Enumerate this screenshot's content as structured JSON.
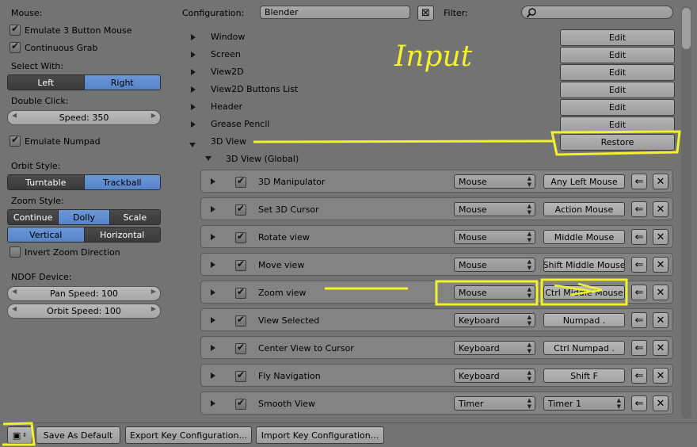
{
  "left": {
    "mouse_label": "Mouse:",
    "emulate3": "Emulate 3 Button Mouse",
    "continuous_grab": "Continuous Grab",
    "select_with_label": "Select With:",
    "select_with": [
      "Left",
      "Right"
    ],
    "double_click_label": "Double Click:",
    "double_click_speed": "Speed: 350",
    "emulate_numpad": "Emulate Numpad",
    "orbit_style_label": "Orbit Style:",
    "orbit_style": [
      "Turntable",
      "Trackball"
    ],
    "zoom_style_label": "Zoom Style:",
    "zoom_style": [
      "Continue",
      "Dolly",
      "Scale"
    ],
    "zoom_axis": [
      "Vertical",
      "Horizontal"
    ],
    "invert_zoom": "Invert Zoom Direction",
    "ndof_label": "NDOF Device:",
    "pan_speed": "Pan Speed: 100",
    "orbit_speed": "Orbit Speed: 100"
  },
  "top": {
    "config_label": "Configuration:",
    "config_value": "Blender",
    "filter_label": "Filter:"
  },
  "categories": [
    {
      "name": "Window",
      "button": "Edit"
    },
    {
      "name": "Screen",
      "button": "Edit"
    },
    {
      "name": "View2D",
      "button": "Edit"
    },
    {
      "name": "View2D Buttons List",
      "button": "Edit"
    },
    {
      "name": "Header",
      "button": "Edit"
    },
    {
      "name": "Grease Pencil",
      "button": "Edit"
    },
    {
      "name": "3D View",
      "button": "Restore"
    }
  ],
  "subcategory": "3D View (Global)",
  "keymap_rows": [
    {
      "name": "3D Manipulator",
      "type": "Mouse",
      "key": "Any Left Mouse"
    },
    {
      "name": "Set 3D Cursor",
      "type": "Mouse",
      "key": "Action Mouse"
    },
    {
      "name": "Rotate view",
      "type": "Mouse",
      "key": "Middle Mouse"
    },
    {
      "name": "Move view",
      "type": "Mouse",
      "key": "Shift Middle Mouse"
    },
    {
      "name": "Zoom view",
      "type": "Mouse",
      "key": "Ctrl Middle Mouse"
    },
    {
      "name": "View Selected",
      "type": "Keyboard",
      "key": "Numpad ."
    },
    {
      "name": "Center View to Cursor",
      "type": "Keyboard",
      "key": "Ctrl Numpad ."
    },
    {
      "name": "Fly Navigation",
      "type": "Keyboard",
      "key": "Shift F"
    },
    {
      "name": "Smooth View",
      "type": "Timer",
      "key": "Timer 1"
    }
  ],
  "annotation_text": "Input",
  "bottom": {
    "save_default": "Save As Default",
    "export": "Export Key Configuration...",
    "import": "Import Key Configuration..."
  },
  "colors": {
    "background": "#737373",
    "selected_blue": "#5f8dd0",
    "annotation_yellow": "#f2f22a"
  }
}
